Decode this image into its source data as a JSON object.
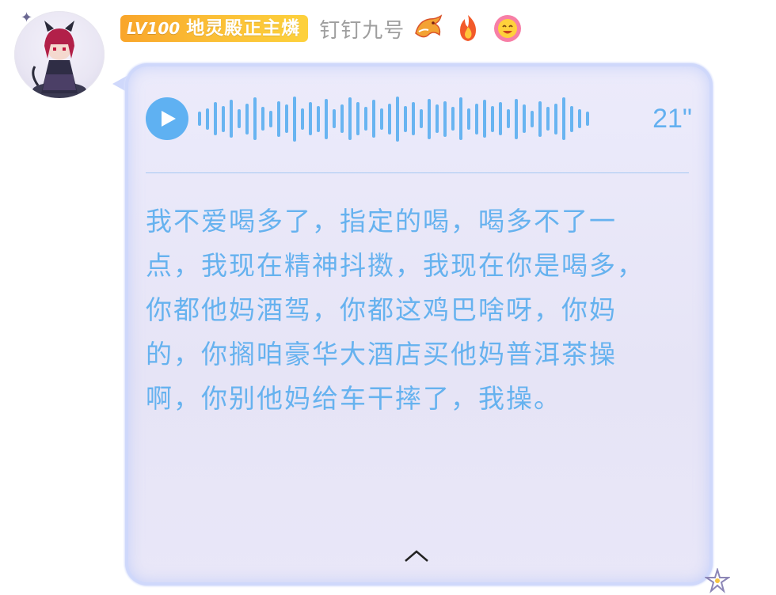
{
  "header": {
    "level_badge": "LV100",
    "title_badge": "地灵殿正主燐",
    "nickname": "钉钉九号"
  },
  "icons": {
    "avatar": "avatar-cat-girl",
    "emblem_1": "dragon-icon",
    "emblem_2": "fire-icon",
    "emblem_3": "smile-flower-icon",
    "play": "play-icon",
    "collapse": "chevron-up-icon",
    "corner": "star-icon"
  },
  "colors": {
    "badge": "#f9a52a",
    "accent_blue": "#5fb1f2",
    "bubble_bg": "#e8e6f7",
    "bubble_border": "#cfd8fb",
    "nickname": "#9e9e9e"
  },
  "voice_message": {
    "duration": "21\"",
    "waveform_levels": [
      0.3,
      0.45,
      0.7,
      0.55,
      0.8,
      0.4,
      0.65,
      0.9,
      0.5,
      0.35,
      0.75,
      0.6,
      0.95,
      0.45,
      0.7,
      0.55,
      0.85,
      0.4,
      0.6,
      0.9,
      0.7,
      0.5,
      0.8,
      0.45,
      0.65,
      0.95,
      0.55,
      0.7,
      0.4,
      0.85,
      0.6,
      0.75,
      0.5,
      0.9,
      0.45,
      0.65,
      0.8,
      0.55,
      0.7,
      0.4,
      0.85,
      0.6,
      0.35,
      0.75,
      0.5,
      0.65,
      0.9,
      0.55,
      0.4,
      0.3
    ],
    "transcript": "我不爱喝多了，指定的喝，喝多不了一点，我现在精神抖擞，我现在你是喝多，你都他妈酒驾，你都这鸡巴啥呀，你妈的，你搁咱豪华大酒店买他妈普洱茶操啊，你别他妈给车干摔了，我操。"
  }
}
